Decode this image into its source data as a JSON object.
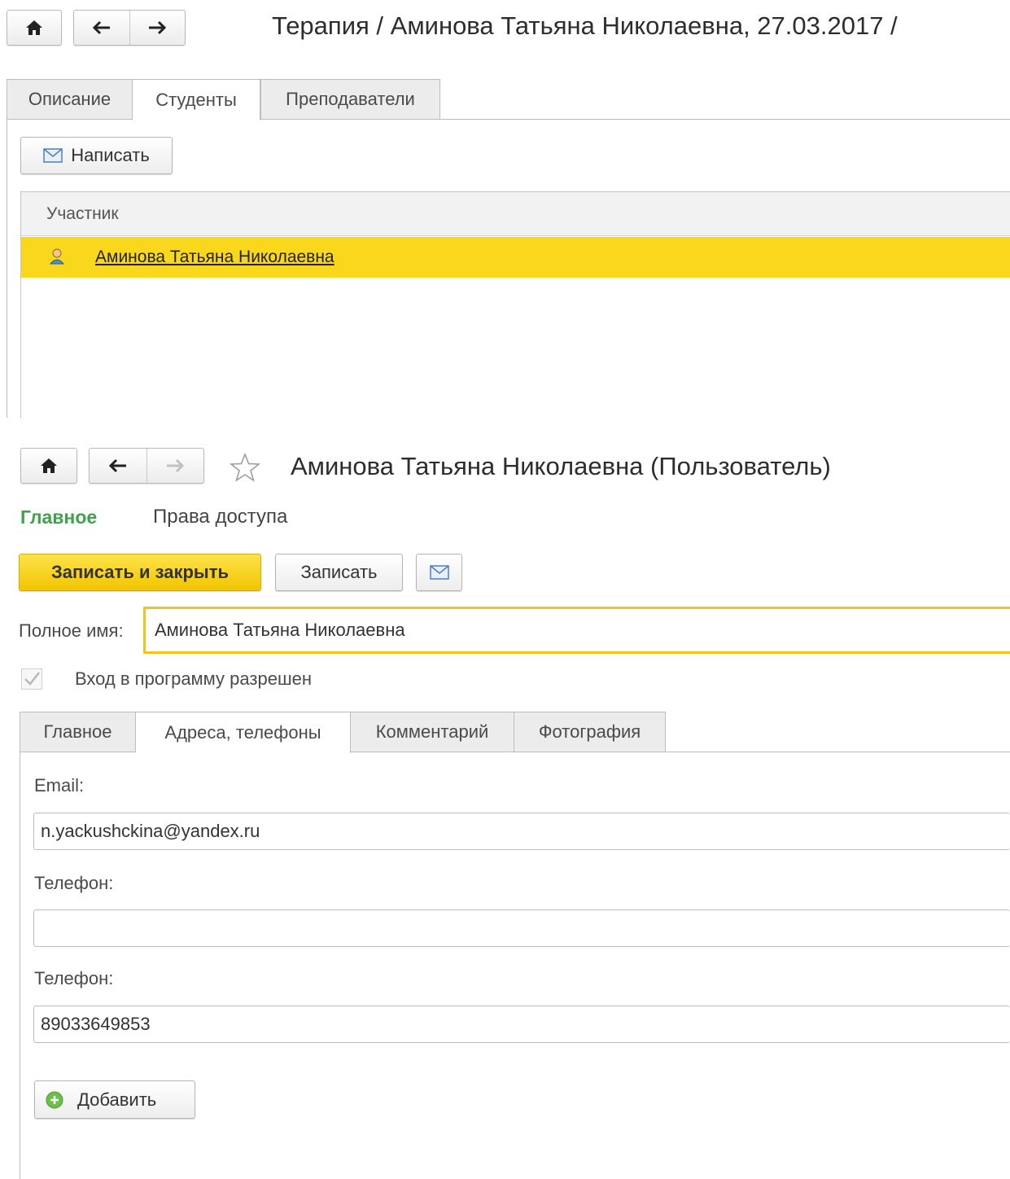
{
  "window1": {
    "title": "Терапия / Аминова Татьяна Николаевна, 27.03.2017 /",
    "tabs": [
      {
        "label": "Описание"
      },
      {
        "label": "Студенты"
      },
      {
        "label": "Преподаватели"
      }
    ],
    "active_tab": "Студенты",
    "write_button": "Написать",
    "table": {
      "header": "Участник",
      "rows": [
        {
          "name": "Аминова Татьяна Николаевна",
          "icon": "user-icon",
          "selected": true
        }
      ]
    }
  },
  "window2": {
    "title": "Аминова Татьяна Николаевна (Пользователь)",
    "sections": [
      {
        "label": "Главное",
        "active": true
      },
      {
        "label": "Права доступа",
        "active": false
      }
    ],
    "buttons": {
      "save_close": "Записать и закрыть",
      "save": "Записать"
    },
    "full_name_label": "Полное имя:",
    "full_name_value": "Аминова Татьяна Николаевна",
    "login_allowed_label": "Вход в программу разрешен",
    "login_allowed": true,
    "tabs": [
      {
        "label": "Главное"
      },
      {
        "label": "Адреса, телефоны"
      },
      {
        "label": "Комментарий"
      },
      {
        "label": "Фотография"
      }
    ],
    "active_tab": "Адреса, телефоны",
    "email_label": "Email:",
    "email_value": "n.yackushckina@yandex.ru",
    "phone1_label": "Телефон:",
    "phone1_value": "",
    "phone2_label": "Телефон:",
    "phone2_value": "89033649853",
    "add_button": "Добавить"
  },
  "colors": {
    "accent_yellow": "#f9d71c",
    "section_active_green": "#3fa14a",
    "input_focus_border": "#f0c419"
  }
}
